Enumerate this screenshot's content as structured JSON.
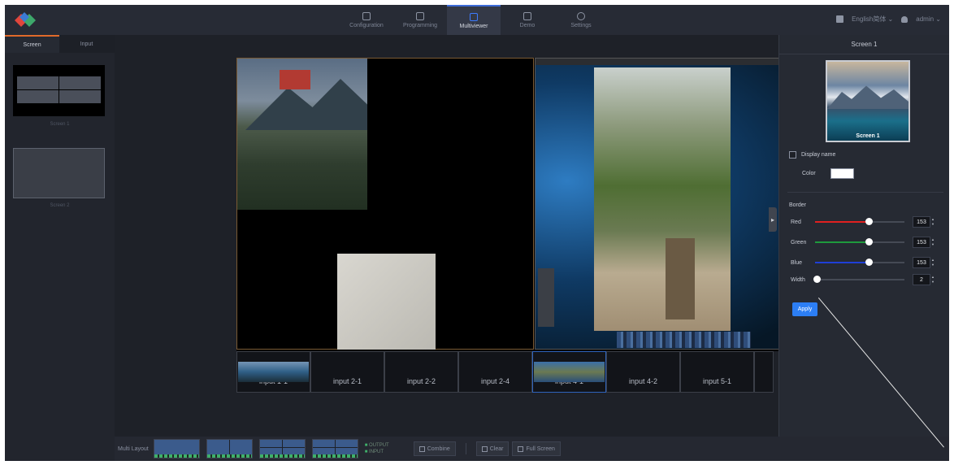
{
  "nav": [
    {
      "label": "Configuration",
      "active": false
    },
    {
      "label": "Programming",
      "active": false
    },
    {
      "label": "Multiviewer",
      "active": true
    },
    {
      "label": "Demo",
      "active": false
    },
    {
      "label": "Settings",
      "active": false
    }
  ],
  "topright": {
    "language": "English简体",
    "user": "admin"
  },
  "left": {
    "tabs": [
      "Screen",
      "Input"
    ],
    "thumbs": [
      {
        "caption": "Screen 1"
      },
      {
        "caption": "Screen 2"
      }
    ]
  },
  "inputs": [
    "input 1-1",
    "input 2-1",
    "input 2-2",
    "input 2-4",
    "input 4-1",
    "input 4-2",
    "input 5-1"
  ],
  "bottom": {
    "multi_layout_label": "Multi Layout",
    "legend_output": "OUTPUT",
    "legend_input": "INPUT",
    "combine_label": "Combine",
    "clear_label": "Clear",
    "fullscreen_label": "Full Screen"
  },
  "panel": {
    "title": "Screen 1",
    "preview_caption": "Screen 1",
    "display_name_label": "Display name",
    "color_label": "Color",
    "color_value": "#ffffff",
    "border_label": "Border",
    "sliders": [
      {
        "label": "Red",
        "value": "153",
        "fraction": 0.6,
        "color": "#e02020"
      },
      {
        "label": "Green",
        "value": "153",
        "fraction": 0.6,
        "color": "#1e9a3c"
      },
      {
        "label": "Blue",
        "value": "153",
        "fraction": 0.6,
        "color": "#1f3fd6"
      },
      {
        "label": "Width",
        "value": "2",
        "fraction": 0.02,
        "color": "#ffffff"
      }
    ],
    "apply_label": "Apply"
  },
  "colors": {
    "accent": "#2c7ef4",
    "active_tab": "#e06a2a"
  }
}
